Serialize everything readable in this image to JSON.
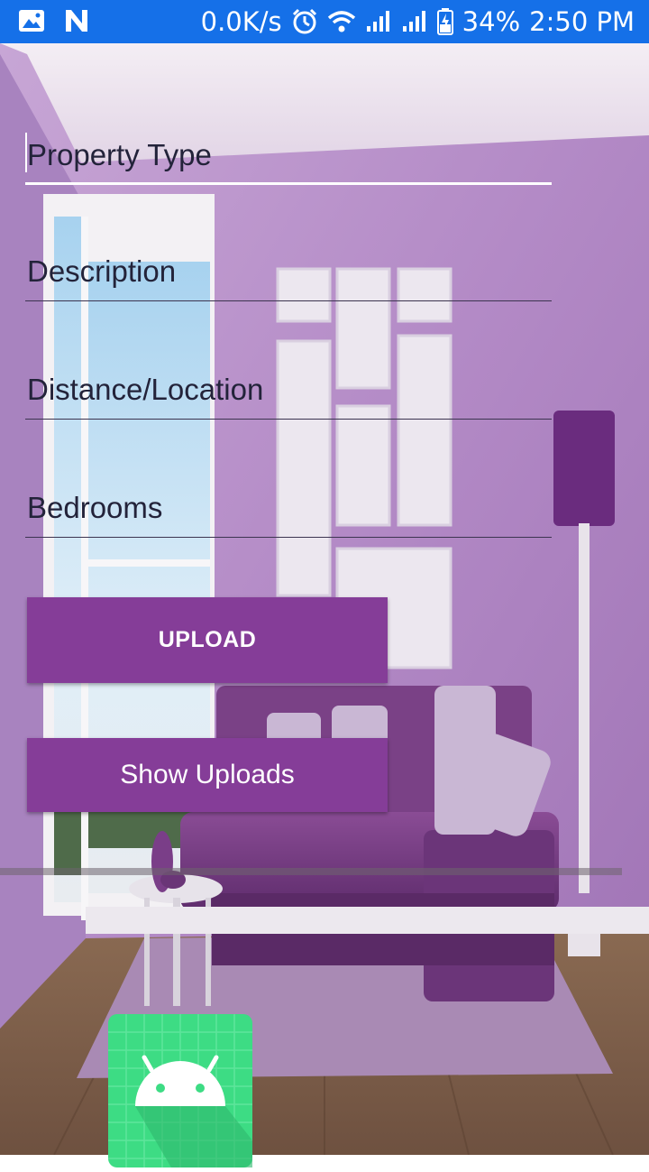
{
  "status_bar": {
    "network_speed": "0.0K/s",
    "battery": "34%",
    "time": "2:50 PM",
    "icons": [
      "image-icon",
      "n-notification-icon",
      "alarm-icon",
      "wifi-icon",
      "signal-icon",
      "signal-icon",
      "battery-icon"
    ]
  },
  "form": {
    "property_type": {
      "value": "",
      "placeholder": "Property Type"
    },
    "description": {
      "value": "",
      "placeholder": "Description"
    },
    "distance": {
      "value": "",
      "placeholder": "Distance/Location"
    },
    "bedrooms": {
      "value": "",
      "placeholder": "Bedrooms"
    }
  },
  "buttons": {
    "upload_label": "UPLOAD",
    "show_uploads_label": "Show Uploads"
  },
  "colors": {
    "status_bar": "#1570e8",
    "button": "#853d98",
    "wall": "#b48cc8",
    "app_icon": "#3ddc84"
  },
  "image": {
    "icon": "android-app-icon"
  }
}
